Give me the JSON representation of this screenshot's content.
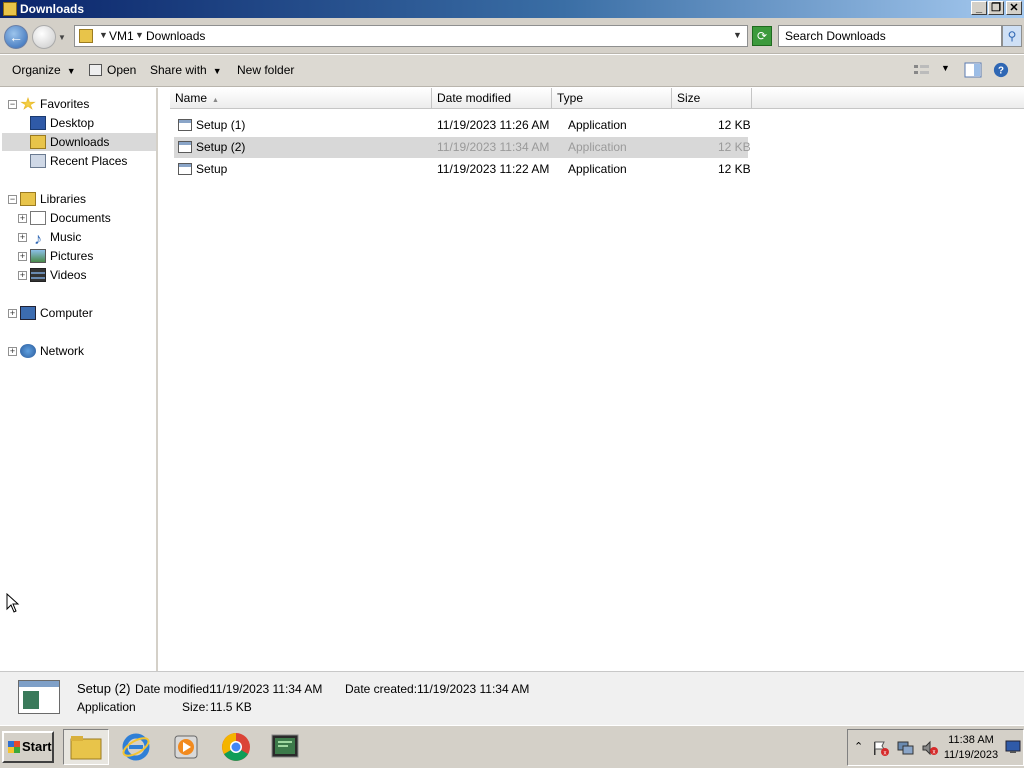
{
  "window": {
    "title": "Downloads"
  },
  "address": {
    "crumbs": [
      "VM1",
      "Downloads"
    ],
    "search_placeholder": "Search Downloads"
  },
  "toolbar": {
    "organize": "Organize",
    "open": "Open",
    "share_with": "Share with",
    "new_folder": "New folder"
  },
  "nav": {
    "favorites": "Favorites",
    "desktop": "Desktop",
    "downloads": "Downloads",
    "recent_places": "Recent Places",
    "libraries": "Libraries",
    "documents": "Documents",
    "music": "Music",
    "pictures": "Pictures",
    "videos": "Videos",
    "computer": "Computer",
    "network": "Network"
  },
  "columns": {
    "name": "Name",
    "date_modified": "Date modified",
    "type": "Type",
    "size": "Size"
  },
  "files": [
    {
      "name": "Setup (1)",
      "date": "11/19/2023 11:26 AM",
      "type": "Application",
      "size": "12 KB"
    },
    {
      "name": "Setup (2)",
      "date": "11/19/2023 11:34 AM",
      "type": "Application",
      "size": "12 KB"
    },
    {
      "name": "Setup",
      "date": "11/19/2023 11:22 AM",
      "type": "Application",
      "size": "12 KB"
    }
  ],
  "details": {
    "name": "Setup (2)",
    "type": "Application",
    "date_modified_label": "Date modified:",
    "date_modified": "11/19/2023 11:34 AM",
    "date_created_label": "Date created:",
    "date_created": "11/19/2023 11:34 AM",
    "size_label": "Size:",
    "size": "11.5 KB"
  },
  "taskbar": {
    "start": "Start",
    "time": "11:38 AM",
    "date": "11/19/2023"
  }
}
